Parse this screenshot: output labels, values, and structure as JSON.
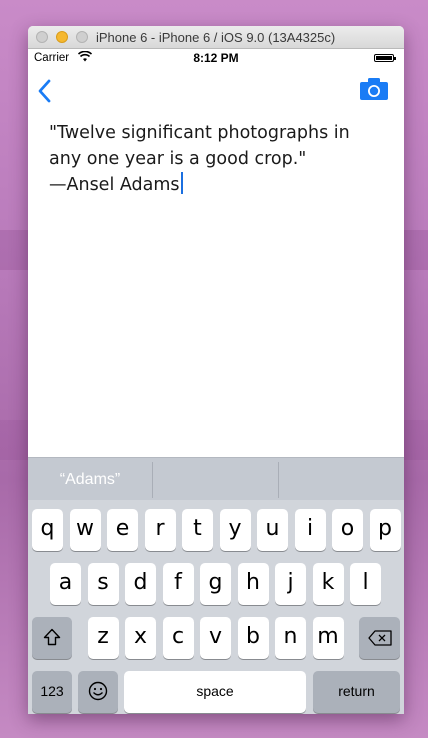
{
  "window": {
    "title": "iPhone 6 - iPhone 6 / iOS 9.0 (13A4325c)"
  },
  "status_bar": {
    "carrier": "Carrier",
    "time": "8:12 PM"
  },
  "nav": {
    "back_icon": "chevron-left-icon",
    "camera_icon": "camera-icon",
    "accent": "#1a7cf5"
  },
  "text_view": {
    "lines": [
      "\"Twelve significant photographs in",
      "any one year is a good crop.\"",
      "—Ansel Adams"
    ]
  },
  "suggestions": [
    "“Adams”",
    "",
    ""
  ],
  "keyboard": {
    "row1": [
      "q",
      "w",
      "e",
      "r",
      "t",
      "y",
      "u",
      "i",
      "o",
      "p"
    ],
    "row2": [
      "a",
      "s",
      "d",
      "f",
      "g",
      "h",
      "j",
      "k",
      "l"
    ],
    "row3": [
      "z",
      "x",
      "c",
      "v",
      "b",
      "n",
      "m"
    ],
    "shift_icon": "shift-icon",
    "delete_icon": "delete-icon",
    "numbers_label": "123",
    "emoji_icon": "emoji-icon",
    "space_label": "space",
    "return_label": "return"
  }
}
